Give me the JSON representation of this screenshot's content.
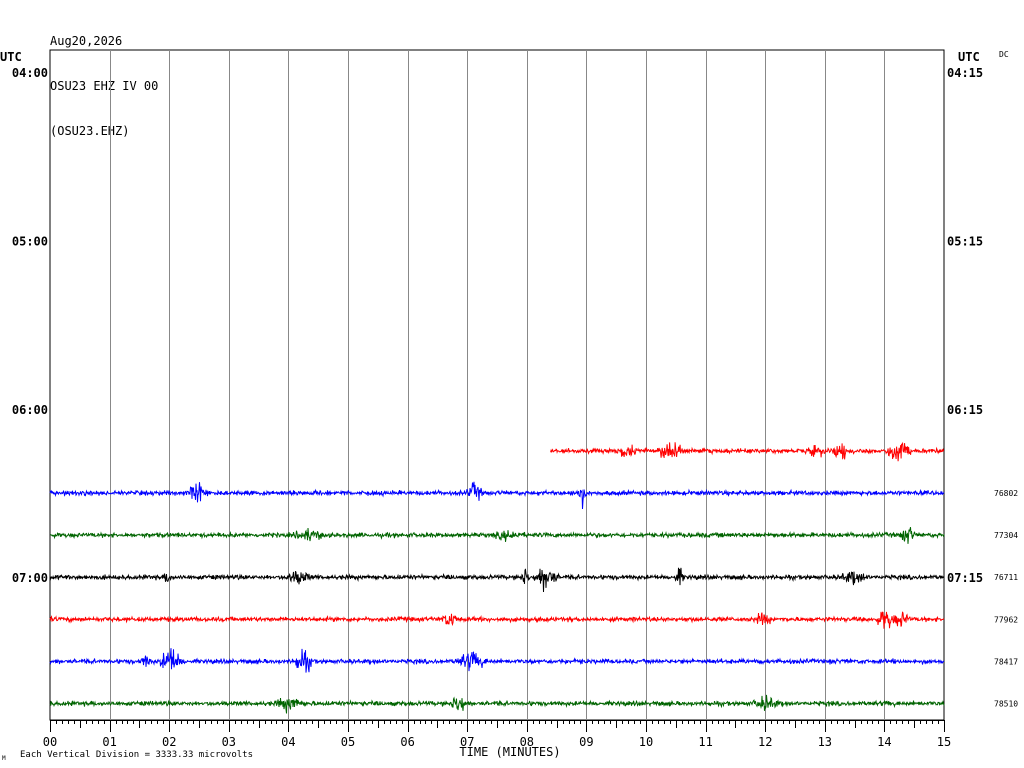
{
  "header": {
    "date": "Aug20,2026",
    "station": "OSU23 EHZ IV 00",
    "channel": "(OSU23.EHZ)"
  },
  "utc_label_left": "UTC",
  "utc_label_right": "UTC",
  "dc_label": "DC",
  "footer_note": "Each Vertical Division = 3333.33 microvolts",
  "footer_mark": "M",
  "colors": {
    "red": "#ff0000",
    "blue": "#0000ff",
    "green": "#006400",
    "black": "#000000",
    "grid": "#888888"
  },
  "chart_data": {
    "type": "line",
    "xlabel": "TIME (MINUTES)",
    "x_ticks": [
      "00",
      "01",
      "02",
      "03",
      "04",
      "05",
      "06",
      "07",
      "08",
      "09",
      "10",
      "11",
      "12",
      "13",
      "14",
      "15"
    ],
    "xlim": [
      0,
      15
    ],
    "left_time_labels": [
      {
        "label": "04:00",
        "row": 0
      },
      {
        "label": "05:00",
        "row": 4
      },
      {
        "label": "06:00",
        "row": 8
      },
      {
        "label": "07:00",
        "row": 12
      }
    ],
    "right_time_labels": [
      {
        "label": "04:15",
        "row": 0
      },
      {
        "label": "05:15",
        "row": 4
      },
      {
        "label": "06:15",
        "row": 8
      },
      {
        "label": "07:15",
        "row": 12
      }
    ],
    "rows_total": 16,
    "traces": [
      {
        "row": 9,
        "color": "red",
        "start_min": 8.4,
        "end_min": 15,
        "offset_label": ""
      },
      {
        "row": 10,
        "color": "blue",
        "start_min": 0,
        "end_min": 15,
        "offset_label": "76802"
      },
      {
        "row": 11,
        "color": "green",
        "start_min": 0,
        "end_min": 15,
        "offset_label": "77304"
      },
      {
        "row": 12,
        "color": "black",
        "start_min": 0,
        "end_min": 15,
        "offset_label": "76711"
      },
      {
        "row": 13,
        "color": "red",
        "start_min": 0,
        "end_min": 15,
        "offset_label": "77962"
      },
      {
        "row": 14,
        "color": "blue",
        "start_min": 0,
        "end_min": 15,
        "offset_label": "78417"
      },
      {
        "row": 15,
        "color": "green",
        "start_min": 0,
        "end_min": 15,
        "offset_label": "78510"
      }
    ]
  }
}
